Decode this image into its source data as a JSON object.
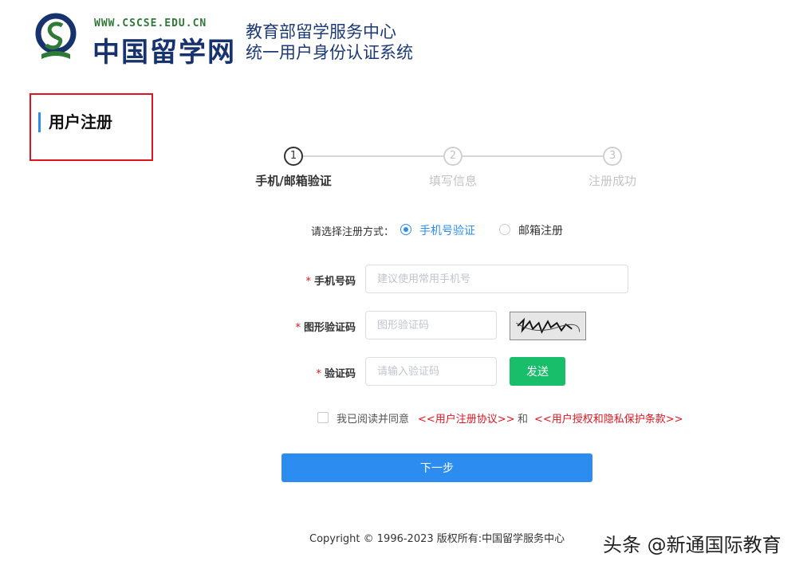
{
  "header": {
    "logo_url": "WWW.CSCSE.EDU.CN",
    "logo_name": "中国留学网",
    "system_title_line1": "教育部留学服务中心",
    "system_title_line2": "统一用户身份认证系统"
  },
  "side": {
    "title": "用户注册"
  },
  "steps": [
    {
      "number": "1",
      "label": "手机/邮箱验证",
      "active": true
    },
    {
      "number": "2",
      "label": "填写信息",
      "active": false
    },
    {
      "number": "3",
      "label": "注册成功",
      "active": false
    }
  ],
  "method": {
    "label": "请选择注册方式：",
    "options": [
      "手机号验证",
      "邮箱注册"
    ],
    "selected": "手机号验证"
  },
  "form": {
    "phone": {
      "label": "手机号码",
      "placeholder": "建议使用常用手机号"
    },
    "captcha": {
      "label": "图形验证码",
      "placeholder": "图形验证码"
    },
    "code": {
      "label": "验证码",
      "placeholder": "请输入验证码"
    },
    "send_label": "发送",
    "required_mark": "*"
  },
  "agreement": {
    "text": "我已阅读并同意",
    "link1": "<<用户注册协议>>",
    "conjunction": "和",
    "link2": "<<用户授权和隐私保护条款>>",
    "checked": false
  },
  "next_label": "下一步",
  "footer": {
    "copyright": "Copyright © 1996-2023 版权所有:中国留学服务中心"
  },
  "watermark": "头条 @新通国际教育",
  "colors": {
    "primary": "#2d8cf0",
    "success": "#19be6b",
    "danger": "#e0141e",
    "brand_blue": "#1d3a78",
    "brand_green": "#2e7a36"
  }
}
